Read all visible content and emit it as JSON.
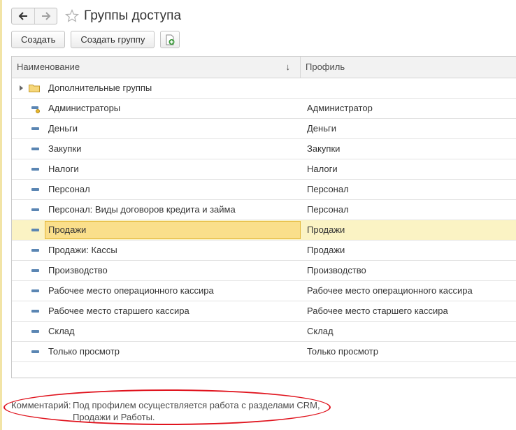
{
  "window": {
    "title": "Группы доступа"
  },
  "toolbar": {
    "create_label": "Создать",
    "create_group_label": "Создать группу"
  },
  "table": {
    "columns": [
      "Наименование",
      "Профиль"
    ],
    "sort_indicator": "↓",
    "rows": [
      {
        "name": "Дополнительные группы",
        "profile": "",
        "type": "folder"
      },
      {
        "name": "Администраторы",
        "profile": "Администратор",
        "type": "admin"
      },
      {
        "name": "Деньги",
        "profile": "Деньги",
        "type": "group"
      },
      {
        "name": "Закупки",
        "profile": "Закупки",
        "type": "group"
      },
      {
        "name": "Налоги",
        "profile": "Налоги",
        "type": "group"
      },
      {
        "name": "Персонал",
        "profile": "Персонал",
        "type": "group"
      },
      {
        "name": "Персонал: Виды договоров кредита и займа",
        "profile": "Персонал",
        "type": "group"
      },
      {
        "name": "Продажи",
        "profile": "Продажи",
        "type": "group",
        "selected": true
      },
      {
        "name": "Продажи: Кассы",
        "profile": "Продажи",
        "type": "group"
      },
      {
        "name": "Производство",
        "profile": "Производство",
        "type": "group"
      },
      {
        "name": "Рабочее место операционного кассира",
        "profile": "Рабочее место операционного кассира",
        "type": "group"
      },
      {
        "name": "Рабочее место старшего кассира",
        "profile": "Рабочее место старшего кассира",
        "type": "group"
      },
      {
        "name": "Склад",
        "profile": "Склад",
        "type": "group"
      },
      {
        "name": "Только просмотр",
        "profile": "Только просмотр",
        "type": "group"
      }
    ]
  },
  "comment": {
    "label": "Комментарий:",
    "text_line1": "Под профилем осуществляется работа с разделами CRM,",
    "text_line2": "Продажи и Работы."
  },
  "colors": {
    "selected_row": "#fbf3c4",
    "selected_cell": "#fadf8b",
    "highlight_ellipse": "#e0141e",
    "group_icon": "#5b86b3"
  }
}
